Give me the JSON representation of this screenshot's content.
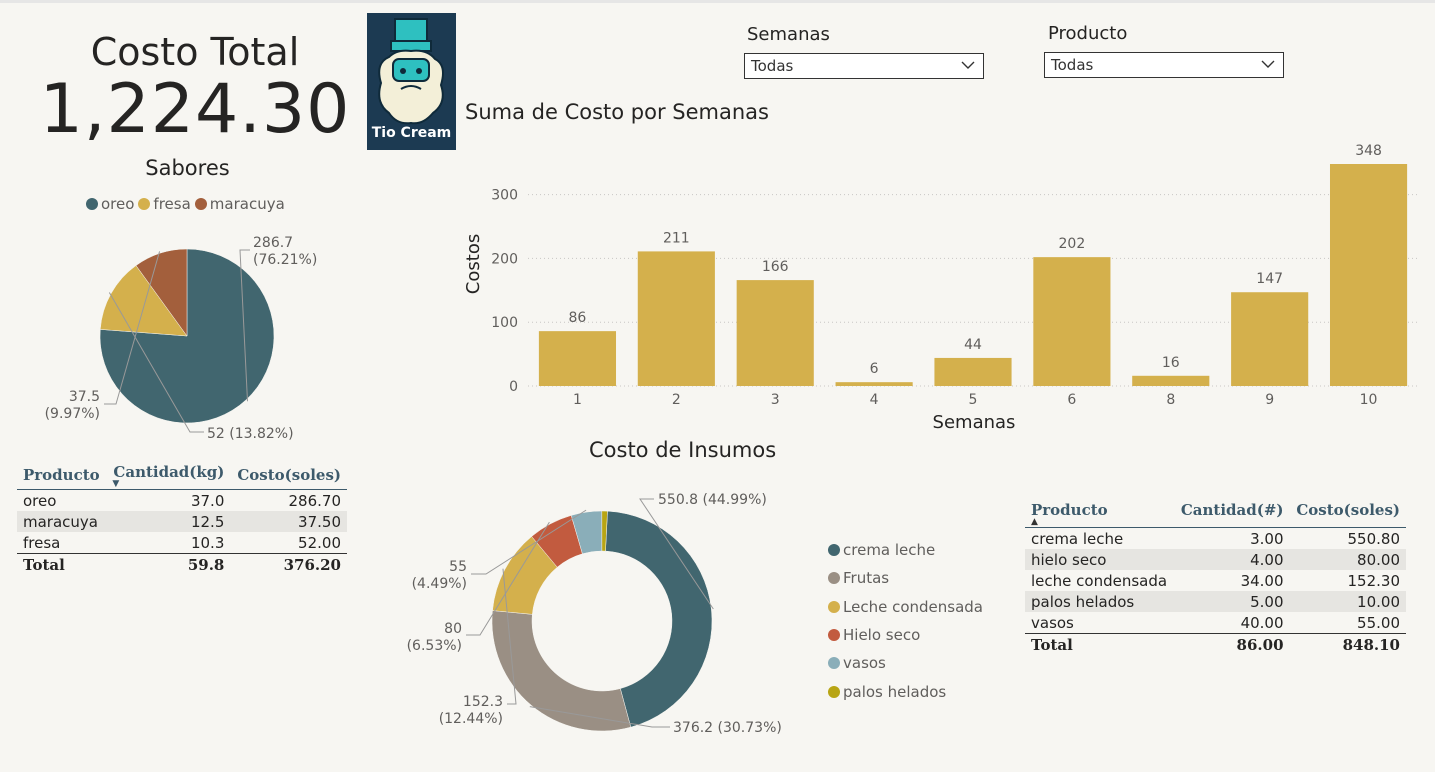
{
  "kpi": {
    "title": "Costo Total",
    "value": "1,224.30"
  },
  "logo": {
    "text": "Tio Cream"
  },
  "slicers": [
    {
      "label": "Semanas",
      "value": "Todas"
    },
    {
      "label": "Producto",
      "value": "Todas"
    }
  ],
  "colors": {
    "teal": "#41666f",
    "gold": "#d4b04c",
    "rust": "#a35f3c",
    "taupe": "#9a8f84",
    "red": "#c25b3f",
    "lightblue": "#8aaeb9",
    "olive": "#b8a514",
    "barfill": "#d4b04c"
  },
  "sabores": {
    "title": "Sabores",
    "legend": [
      {
        "name": "oreo",
        "color": "#41666f"
      },
      {
        "name": "fresa",
        "color": "#d4b04c"
      },
      {
        "name": "maracuya",
        "color": "#a35f3c"
      }
    ]
  },
  "bar_section": {
    "title": "Suma de Costo por Semanas"
  },
  "insumos_section": {
    "title": "Costo de Insumos",
    "legend": [
      {
        "name": "crema leche",
        "color": "#41666f"
      },
      {
        "name": "Frutas",
        "color": "#9a8f84"
      },
      {
        "name": "Leche condensada",
        "color": "#d4b04c"
      },
      {
        "name": "Hielo seco",
        "color": "#c25b3f"
      },
      {
        "name": "vasos",
        "color": "#8aaeb9"
      },
      {
        "name": "palos helados",
        "color": "#b8a514"
      }
    ]
  },
  "table_sabores": {
    "headers": [
      "Producto",
      "Cantidad(kg)",
      "Costo(soles)"
    ],
    "rows": [
      [
        "oreo",
        "37.0",
        "286.70"
      ],
      [
        "maracuya",
        "12.5",
        "37.50"
      ],
      [
        "fresa",
        "10.3",
        "52.00"
      ]
    ],
    "total": [
      "Total",
      "59.8",
      "376.20"
    ]
  },
  "table_insumos": {
    "headers": [
      "Producto",
      "Cantidad(#)",
      "Costo(soles)"
    ],
    "rows": [
      [
        "crema leche",
        "3.00",
        "550.80"
      ],
      [
        "hielo seco",
        "4.00",
        "80.00"
      ],
      [
        "leche condensada",
        "34.00",
        "152.30"
      ],
      [
        "palos helados",
        "5.00",
        "10.00"
      ],
      [
        "vasos",
        "40.00",
        "55.00"
      ]
    ],
    "total": [
      "Total",
      "86.00",
      "848.10"
    ]
  },
  "chart_data": [
    {
      "type": "pie",
      "title": "Sabores",
      "slices": [
        {
          "name": "oreo",
          "value": 286.7,
          "label": "286.7",
          "pct": "(76.21%)",
          "color": "#41666f"
        },
        {
          "name": "fresa",
          "value": 52,
          "label": "52 (13.82%)",
          "pct": "",
          "color": "#d4b04c"
        },
        {
          "name": "maracuya",
          "value": 37.5,
          "label": "37.5",
          "pct": "(9.97%)",
          "color": "#a35f3c"
        }
      ]
    },
    {
      "type": "bar",
      "title": "Suma de Costo por Semanas",
      "xlabel": "Semanas",
      "ylabel": "Costos",
      "categories": [
        "1",
        "2",
        "3",
        "4",
        "5",
        "6",
        "8",
        "9",
        "10"
      ],
      "values": [
        86,
        211,
        166,
        6,
        44,
        202,
        16,
        147,
        348
      ],
      "yticks": [
        0,
        100,
        200,
        300
      ],
      "ylim": [
        0,
        348
      ],
      "grid": true
    },
    {
      "type": "pie",
      "title": "Costo de Insumos",
      "donut": true,
      "slices": [
        {
          "name": "crema leche",
          "value": 550.8,
          "label": "550.8 (44.99%)",
          "pct": "",
          "color": "#41666f"
        },
        {
          "name": "Frutas",
          "value": 376.2,
          "label": "376.2 (30.73%)",
          "pct": "",
          "color": "#9a8f84"
        },
        {
          "name": "Leche condensada",
          "value": 152.3,
          "label": "152.3",
          "pct": "(12.44%)",
          "color": "#d4b04c"
        },
        {
          "name": "Hielo seco",
          "value": 80,
          "label": "80",
          "pct": "(6.53%)",
          "color": "#c25b3f"
        },
        {
          "name": "vasos",
          "value": 55,
          "label": "55",
          "pct": "(4.49%)",
          "color": "#8aaeb9"
        },
        {
          "name": "palos helados",
          "value": 10,
          "label": "",
          "pct": "",
          "color": "#b8a514"
        }
      ]
    }
  ]
}
